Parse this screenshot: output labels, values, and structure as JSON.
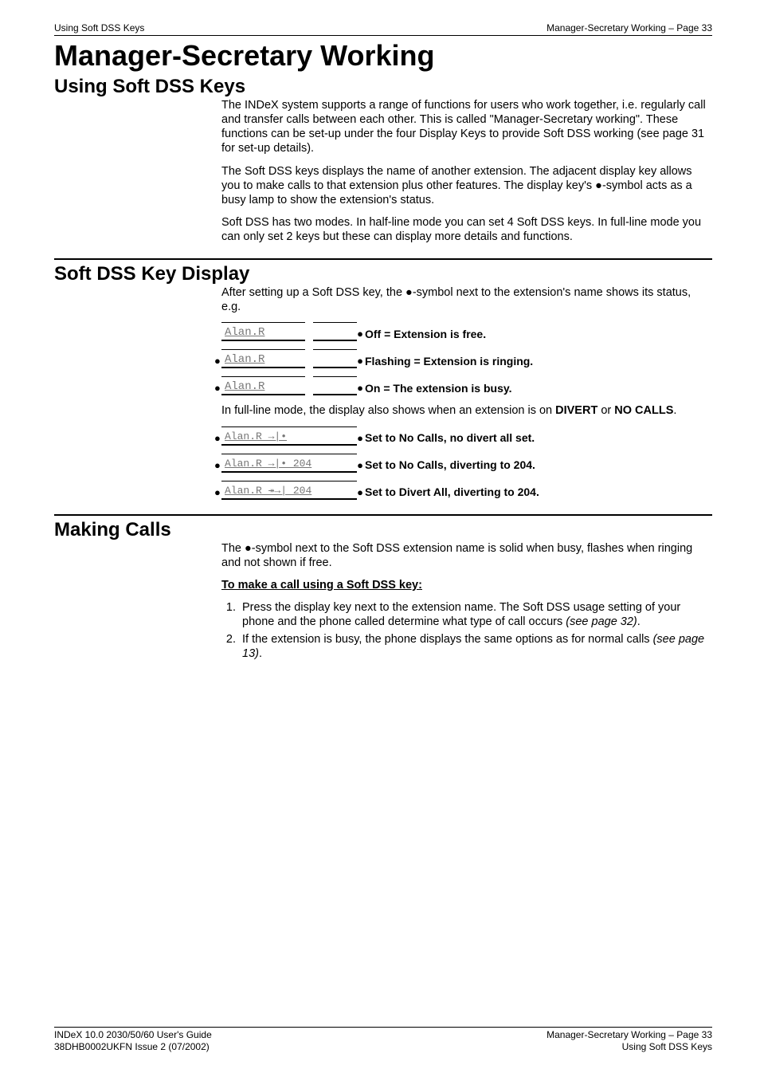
{
  "runhead": {
    "left": "Using Soft DSS Keys",
    "right": "Manager-Secretary Working – Page 33"
  },
  "title": "Manager-Secretary Working",
  "sections": {
    "using": {
      "heading": "Using Soft DSS Keys",
      "p1": "The INDeX system supports a range of functions for users who work together, i.e. regularly call and transfer calls between each other. This is called \"Manager-Secretary working\". These functions can be set-up under the four Display Keys to provide Soft DSS working (see page 31 for set-up details).",
      "p2a": "The Soft DSS keys displays the name of another extension. The adjacent display key allows you to make calls to that extension plus other features. The display key's ",
      "p2b": "-symbol acts as a busy lamp to show the extension's status.",
      "p3": "Soft DSS has two modes. In half-line mode you can set 4 Soft DSS keys. In full-line mode you can only set 2 keys but these can display more details and functions."
    },
    "display": {
      "heading": "Soft DSS Key Display",
      "intro_a": "After setting up a Soft DSS key, the ",
      "intro_b": "-symbol next to the extension's name shows its status, e.g.",
      "rows_half": [
        {
          "lcd": "Alan.R",
          "leftdot": false,
          "label": "Off = Extension is free."
        },
        {
          "lcd": "Alan.R",
          "leftdot": true,
          "label": "Flashing = Extension is ringing."
        },
        {
          "lcd": "Alan.R",
          "leftdot": true,
          "label": "On = The extension is busy."
        }
      ],
      "mid_a": "In full-line mode, the display also shows when an extension is on ",
      "mid_divert": "DIVERT",
      "mid_or": " or ",
      "mid_nocalls": "NO CALLS",
      "mid_dot": ".",
      "rows_full": [
        {
          "lcd": "Alan.R →|•",
          "label": "Set to No Calls, no divert all set."
        },
        {
          "lcd": "Alan.R →|• 204",
          "label": "Set to No Calls, diverting to 204."
        },
        {
          "lcd": "Alan.R ↠→| 204",
          "label": "Set to Divert All, diverting to 204."
        }
      ]
    },
    "making": {
      "heading": "Making Calls",
      "p1a": "The ",
      "p1b": "-symbol next to the Soft DSS extension name is solid when busy, flashes when ringing and not shown if free.",
      "procTitle": "To make a call using a Soft DSS key:",
      "steps": [
        {
          "text": "Press the display key next to the extension name. The Soft DSS usage setting of your phone and the phone called determine what type of call occurs ",
          "ref": "(see page 32)",
          "tail": "."
        },
        {
          "text": "If the extension is busy, the phone displays the same options as for normal calls ",
          "ref": "(see page 13)",
          "tail": "."
        }
      ]
    }
  },
  "bullet": "●",
  "footer": {
    "left1": "INDeX 10.0 2030/50/60 User's Guide",
    "left2": "38DHB0002UKFN Issue 2 (07/2002)",
    "right1": "Manager-Secretary Working – Page 33",
    "right2": "Using Soft DSS Keys"
  }
}
